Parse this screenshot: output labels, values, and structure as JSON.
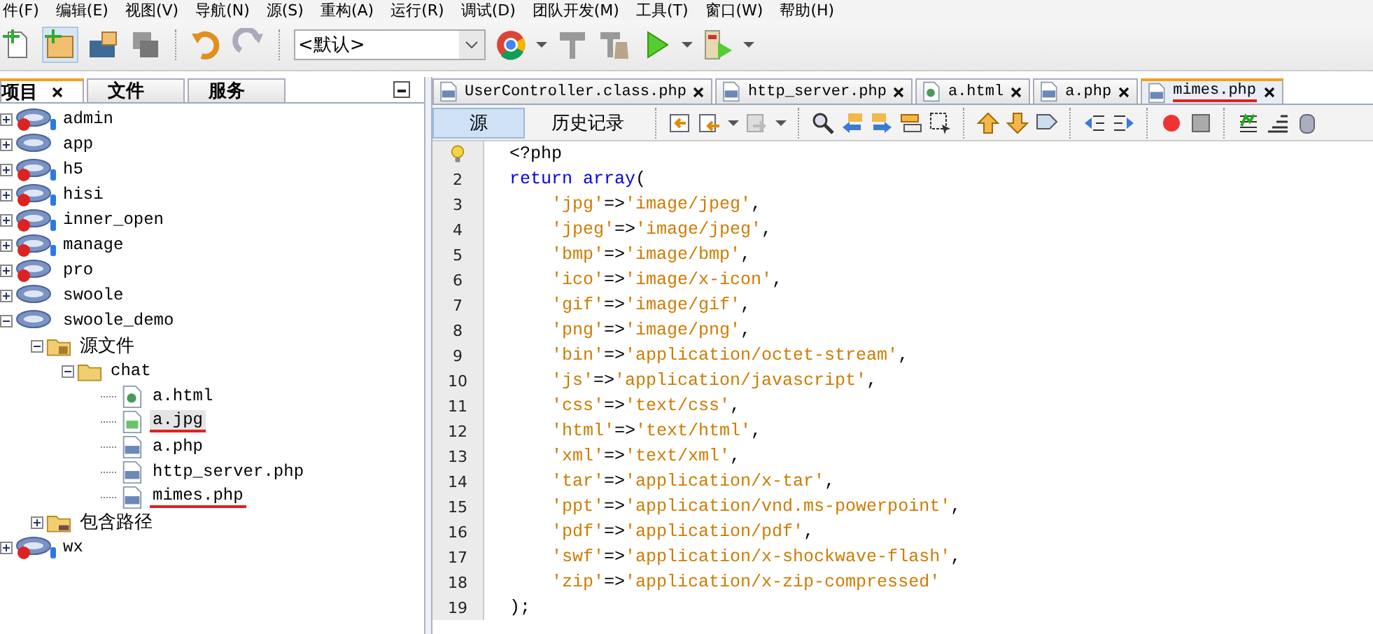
{
  "menu": [
    "件(F)",
    "编辑(E)",
    "视图(V)",
    "导航(N)",
    "源(S)",
    "重构(A)",
    "运行(R)",
    "调试(D)",
    "团队开发(M)",
    "工具(T)",
    "窗口(W)",
    "帮助(H)"
  ],
  "toolbar": {
    "config_value": "<默认>"
  },
  "projects_panel": {
    "tabs": [
      {
        "label": "项目",
        "selected": true,
        "closable": true
      },
      {
        "label": "文件",
        "selected": false,
        "closable": false
      },
      {
        "label": "服务",
        "selected": false,
        "closable": false
      }
    ],
    "tree": [
      {
        "label": "admin",
        "kind": "php-project",
        "error": true,
        "db": true,
        "expanded": false
      },
      {
        "label": "app",
        "kind": "php-project",
        "error": false,
        "db": false,
        "expanded": false
      },
      {
        "label": "h5",
        "kind": "php-project",
        "error": true,
        "db": true,
        "expanded": false
      },
      {
        "label": "hisi",
        "kind": "php-project",
        "error": true,
        "db": true,
        "expanded": false
      },
      {
        "label": "inner_open",
        "kind": "php-project",
        "error": true,
        "db": true,
        "expanded": false
      },
      {
        "label": "manage",
        "kind": "php-project",
        "error": true,
        "db": true,
        "expanded": false
      },
      {
        "label": "pro",
        "kind": "php-project",
        "error": true,
        "db": false,
        "expanded": false
      },
      {
        "label": "swoole",
        "kind": "php-project",
        "error": false,
        "db": false,
        "expanded": false
      },
      {
        "label": "swoole_demo",
        "kind": "php-project",
        "error": false,
        "db": false,
        "expanded": true,
        "children": [
          {
            "label": "源文件",
            "kind": "source-folder",
            "expanded": true,
            "children": [
              {
                "label": "chat",
                "kind": "folder",
                "expanded": true,
                "children": [
                  {
                    "label": "a.html",
                    "kind": "html-file",
                    "selected": false,
                    "underlined": false
                  },
                  {
                    "label": "a.jpg",
                    "kind": "image-file",
                    "selected": true,
                    "underlined": true
                  },
                  {
                    "label": "a.php",
                    "kind": "php-file",
                    "selected": false,
                    "underlined": false
                  },
                  {
                    "label": "http_server.php",
                    "kind": "php-file",
                    "selected": false,
                    "underlined": false
                  },
                  {
                    "label": "mimes.php",
                    "kind": "php-file",
                    "selected": false,
                    "underlined": true
                  }
                ]
              }
            ]
          },
          {
            "label": "包含路径",
            "kind": "include-folder",
            "expanded": false
          }
        ]
      },
      {
        "label": "wx",
        "kind": "php-project",
        "error": true,
        "db": true,
        "expanded": false
      }
    ]
  },
  "editor": {
    "tabs": [
      {
        "label": "UserController.class.php",
        "kind": "php",
        "selected": false,
        "underlined": false
      },
      {
        "label": "http_server.php",
        "kind": "php",
        "selected": false,
        "underlined": false
      },
      {
        "label": "a.html",
        "kind": "html",
        "selected": false,
        "underlined": false
      },
      {
        "label": "a.php",
        "kind": "php",
        "selected": false,
        "underlined": false
      },
      {
        "label": "mimes.php",
        "kind": "php",
        "selected": true,
        "underlined": true
      }
    ],
    "views": [
      {
        "label": "源",
        "selected": true
      },
      {
        "label": "历史记录",
        "selected": false
      }
    ],
    "lines": [
      {
        "hint": true,
        "tokens": [
          {
            "t": "<?php",
            "kind": "plain"
          }
        ]
      },
      {
        "number": "2",
        "tokens": [
          {
            "t": "return array",
            "kind": "keyword"
          },
          {
            "t": "(",
            "kind": "plain"
          }
        ]
      },
      {
        "number": "3",
        "tokens": [
          {
            "t": "    'jpg'",
            "kind": "string"
          },
          {
            "t": "=>",
            "kind": "plain"
          },
          {
            "t": "'image/jpeg'",
            "kind": "string"
          },
          {
            "t": ",",
            "kind": "plain"
          }
        ]
      },
      {
        "number": "4",
        "tokens": [
          {
            "t": "    'jpeg'",
            "kind": "string"
          },
          {
            "t": "=>",
            "kind": "plain"
          },
          {
            "t": "'image/jpeg'",
            "kind": "string"
          },
          {
            "t": ",",
            "kind": "plain"
          }
        ]
      },
      {
        "number": "5",
        "tokens": [
          {
            "t": "    'bmp'",
            "kind": "string"
          },
          {
            "t": "=>",
            "kind": "plain"
          },
          {
            "t": "'image/bmp'",
            "kind": "string"
          },
          {
            "t": ",",
            "kind": "plain"
          }
        ]
      },
      {
        "number": "6",
        "tokens": [
          {
            "t": "    'ico'",
            "kind": "string"
          },
          {
            "t": "=>",
            "kind": "plain"
          },
          {
            "t": "'image/x-icon'",
            "kind": "string"
          },
          {
            "t": ",",
            "kind": "plain"
          }
        ]
      },
      {
        "number": "7",
        "tokens": [
          {
            "t": "    'gif'",
            "kind": "string"
          },
          {
            "t": "=>",
            "kind": "plain"
          },
          {
            "t": "'image/gif'",
            "kind": "string"
          },
          {
            "t": ",",
            "kind": "plain"
          }
        ]
      },
      {
        "number": "8",
        "tokens": [
          {
            "t": "    'png'",
            "kind": "string"
          },
          {
            "t": "=>",
            "kind": "plain"
          },
          {
            "t": "'image/png'",
            "kind": "string"
          },
          {
            "t": ",",
            "kind": "plain"
          }
        ]
      },
      {
        "number": "9",
        "tokens": [
          {
            "t": "    'bin'",
            "kind": "string"
          },
          {
            "t": "=>",
            "kind": "plain"
          },
          {
            "t": "'application/octet-stream'",
            "kind": "string"
          },
          {
            "t": ",",
            "kind": "plain"
          }
        ]
      },
      {
        "number": "10",
        "tokens": [
          {
            "t": "    'js'",
            "kind": "string"
          },
          {
            "t": "=>",
            "kind": "plain"
          },
          {
            "t": "'application/javascript'",
            "kind": "string"
          },
          {
            "t": ",",
            "kind": "plain"
          }
        ]
      },
      {
        "number": "11",
        "tokens": [
          {
            "t": "    'css'",
            "kind": "string"
          },
          {
            "t": "=>",
            "kind": "plain"
          },
          {
            "t": "'text/css'",
            "kind": "string"
          },
          {
            "t": ",",
            "kind": "plain"
          }
        ]
      },
      {
        "number": "12",
        "tokens": [
          {
            "t": "    'html'",
            "kind": "string"
          },
          {
            "t": "=>",
            "kind": "plain"
          },
          {
            "t": "'text/html'",
            "kind": "string"
          },
          {
            "t": ",",
            "kind": "plain"
          }
        ]
      },
      {
        "number": "13",
        "tokens": [
          {
            "t": "    'xml'",
            "kind": "string"
          },
          {
            "t": "=>",
            "kind": "plain"
          },
          {
            "t": "'text/xml'",
            "kind": "string"
          },
          {
            "t": ",",
            "kind": "plain"
          }
        ]
      },
      {
        "number": "14",
        "tokens": [
          {
            "t": "    'tar'",
            "kind": "string"
          },
          {
            "t": "=>",
            "kind": "plain"
          },
          {
            "t": "'application/x-tar'",
            "kind": "string"
          },
          {
            "t": ",",
            "kind": "plain"
          }
        ]
      },
      {
        "number": "15",
        "tokens": [
          {
            "t": "    'ppt'",
            "kind": "string"
          },
          {
            "t": "=>",
            "kind": "plain"
          },
          {
            "t": "'application/vnd.ms-powerpoint'",
            "kind": "string"
          },
          {
            "t": ",",
            "kind": "plain"
          }
        ]
      },
      {
        "number": "16",
        "tokens": [
          {
            "t": "    'pdf'",
            "kind": "string"
          },
          {
            "t": "=>",
            "kind": "plain"
          },
          {
            "t": "'application/pdf'",
            "kind": "string"
          },
          {
            "t": ",",
            "kind": "plain"
          }
        ]
      },
      {
        "number": "17",
        "tokens": [
          {
            "t": "    'swf'",
            "kind": "string"
          },
          {
            "t": "=>",
            "kind": "plain"
          },
          {
            "t": "'application/x-shockwave-flash'",
            "kind": "string"
          },
          {
            "t": ",",
            "kind": "plain"
          }
        ]
      },
      {
        "number": "18",
        "tokens": [
          {
            "t": "    'zip'",
            "kind": "string"
          },
          {
            "t": "=>",
            "kind": "plain"
          },
          {
            "t": "'application/x-zip-compressed'",
            "kind": "string"
          }
        ]
      },
      {
        "number": "19",
        "tokens": [
          {
            "t": ");",
            "kind": "plain"
          }
        ]
      }
    ]
  }
}
